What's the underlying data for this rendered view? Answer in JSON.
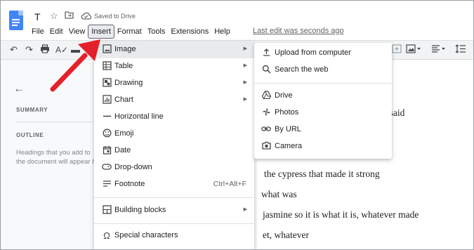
{
  "header": {
    "doc_title": "T",
    "star_icon": "star-icon",
    "folder_icon": "folder-move-icon",
    "cloud_icon": "cloud-done-icon",
    "saved_status": "Saved to Drive",
    "last_edit": "Last edit was seconds ago"
  },
  "menubar": {
    "items": [
      {
        "label": "File"
      },
      {
        "label": "Edit"
      },
      {
        "label": "View"
      },
      {
        "label": "Insert"
      },
      {
        "label": "Format"
      },
      {
        "label": "Tools"
      },
      {
        "label": "Extensions"
      },
      {
        "label": "Help"
      }
    ]
  },
  "outline_panel": {
    "summary_heading": "SUMMARY",
    "outline_heading": "OUTLINE",
    "hint": "Headings that you add to the document will appear he"
  },
  "document": {
    "lines": [
      "as said",
      "the cypress that made it strong",
      "what was",
      "jasmine so it is what it is, whatever made",
      "et, whatever"
    ]
  },
  "insert_menu": {
    "items": [
      {
        "label": "Image",
        "icon": "image-icon",
        "submenu": true,
        "highlighted": true
      },
      {
        "label": "Table",
        "icon": "table-icon",
        "submenu": true
      },
      {
        "label": "Drawing",
        "icon": "drawing-icon",
        "submenu": true
      },
      {
        "label": "Chart",
        "icon": "chart-icon",
        "submenu": true
      },
      {
        "label": "Horizontal line",
        "icon": "horizontal-line-icon"
      },
      {
        "label": "Emoji",
        "icon": "emoji-icon"
      },
      {
        "label": "Date",
        "icon": "calendar-icon"
      },
      {
        "label": "Drop-down",
        "icon": "dropdown-icon"
      },
      {
        "label": "Footnote",
        "icon": "footnote-icon",
        "shortcut": "Ctrl+Alt+F"
      },
      {
        "label": "Building blocks",
        "icon": "building-blocks-icon",
        "submenu": true
      },
      {
        "label": "Special characters",
        "icon": "omega-icon"
      }
    ]
  },
  "image_submenu": {
    "items": [
      {
        "label": "Upload from computer",
        "icon": "upload-icon"
      },
      {
        "label": "Search the web",
        "icon": "search-icon"
      },
      {
        "label": "Drive",
        "icon": "drive-icon"
      },
      {
        "label": "Photos",
        "icon": "photos-icon"
      },
      {
        "label": "By URL",
        "icon": "link-icon"
      },
      {
        "label": "Camera",
        "icon": "camera-icon"
      }
    ]
  },
  "colors": {
    "docs_blue": "#4285f4",
    "menu_highlight": "#e8eaed",
    "annotation_red": "#e5202a"
  }
}
